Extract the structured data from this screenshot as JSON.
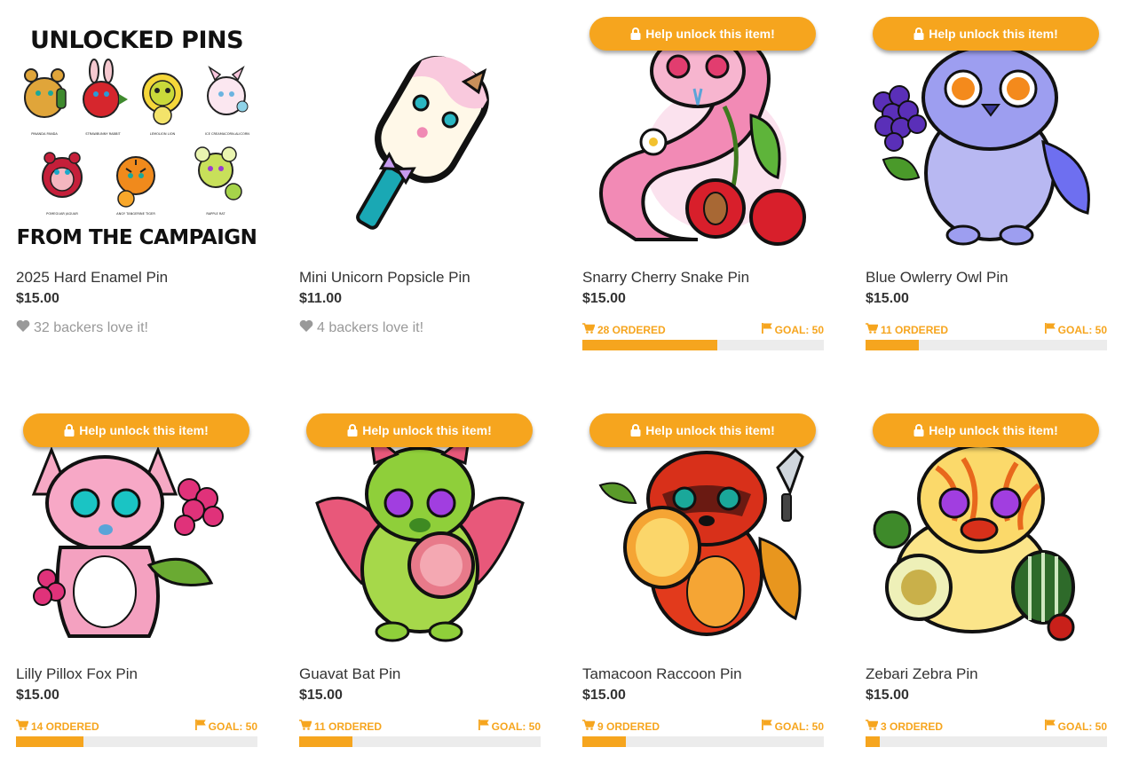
{
  "colors": {
    "accent": "#f6a51e",
    "muted": "#999999",
    "track": "#ececec",
    "text": "#333333"
  },
  "unlock_label": "Help unlock this item!",
  "promo": {
    "title_top": "UNLOCKED PINS",
    "title_bottom": "FROM THE CAMPAIGN",
    "names": [
      "PINANDA PANDA",
      "STRAWBUNNY RABBIT",
      "LEMOLION LION",
      "ICE CREAMACORN-ALICORN",
      "POMEGUAR JAGUAR",
      "ANGY TANGERINE TIGER",
      "RAPPLE RAT"
    ]
  },
  "products": [
    {
      "name": "2025 Hard Enamel Pin",
      "price": "$15.00",
      "love": "32 backers love it!",
      "locked": false,
      "art": "promo"
    },
    {
      "name": "Mini Unicorn Popsicle Pin",
      "price": "$11.00",
      "love": "4 backers love it!",
      "locked": false,
      "art": "popsicle"
    },
    {
      "name": "Snarry Cherry Snake Pin",
      "price": "$15.00",
      "locked": true,
      "ordered": "28 ORDERED",
      "goal": "GOAL: 50",
      "progress": 0.56,
      "art": "snake"
    },
    {
      "name": "Blue Owlerry Owl Pin",
      "price": "$15.00",
      "locked": true,
      "ordered": "11 ORDERED",
      "goal": "GOAL: 50",
      "progress": 0.22,
      "art": "owl"
    },
    {
      "name": "Lilly Pillox Fox Pin",
      "price": "$15.00",
      "locked": true,
      "ordered": "14 ORDERED",
      "goal": "GOAL: 50",
      "progress": 0.28,
      "art": "fox"
    },
    {
      "name": "Guavat Bat Pin",
      "price": "$15.00",
      "locked": true,
      "ordered": "11 ORDERED",
      "goal": "GOAL: 50",
      "progress": 0.22,
      "art": "bat"
    },
    {
      "name": "Tamacoon Raccoon Pin",
      "price": "$15.00",
      "locked": true,
      "ordered": "9 ORDERED",
      "goal": "GOAL: 50",
      "progress": 0.18,
      "art": "raccoon"
    },
    {
      "name": "Zebari Zebra Pin",
      "price": "$15.00",
      "locked": true,
      "ordered": "3 ORDERED",
      "goal": "GOAL: 50",
      "progress": 0.06,
      "art": "zebra"
    }
  ]
}
